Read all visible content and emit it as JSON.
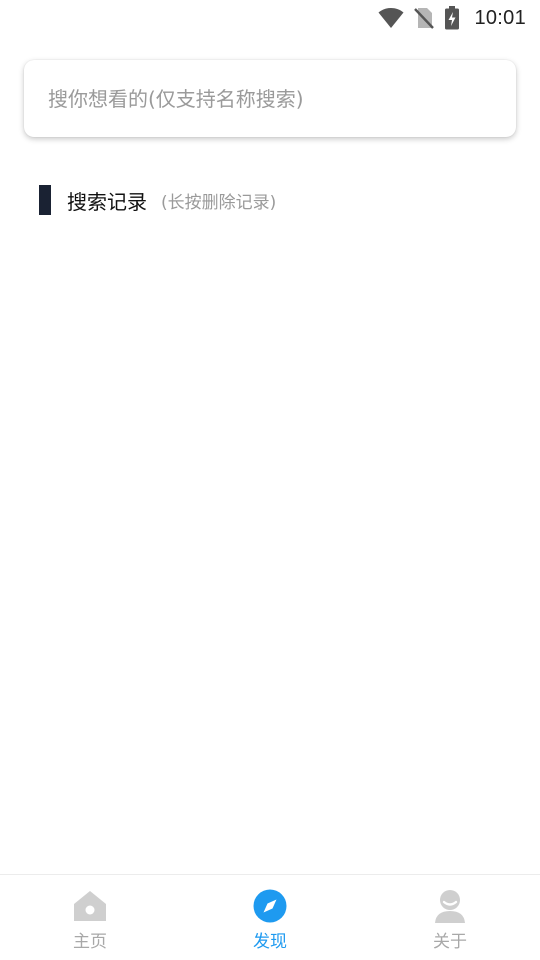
{
  "status_bar": {
    "time": "10:01",
    "icons": [
      "wifi-icon",
      "no-sim-icon",
      "battery-charging-icon"
    ]
  },
  "search": {
    "placeholder": "搜你想看的(仅支持名称搜索)",
    "value": ""
  },
  "history": {
    "title": "搜索记录",
    "hint": "(长按删除记录)",
    "items": []
  },
  "bottom_nav": {
    "items": [
      {
        "label": "主页",
        "icon": "home-icon",
        "active": false
      },
      {
        "label": "发现",
        "icon": "compass-icon",
        "active": true
      },
      {
        "label": "关于",
        "icon": "person-icon",
        "active": false
      }
    ]
  },
  "colors": {
    "accent": "#1e9af0",
    "inactive": "#a8a8a8",
    "section_bar": "#1a2233",
    "placeholder": "#9a9a9a"
  }
}
